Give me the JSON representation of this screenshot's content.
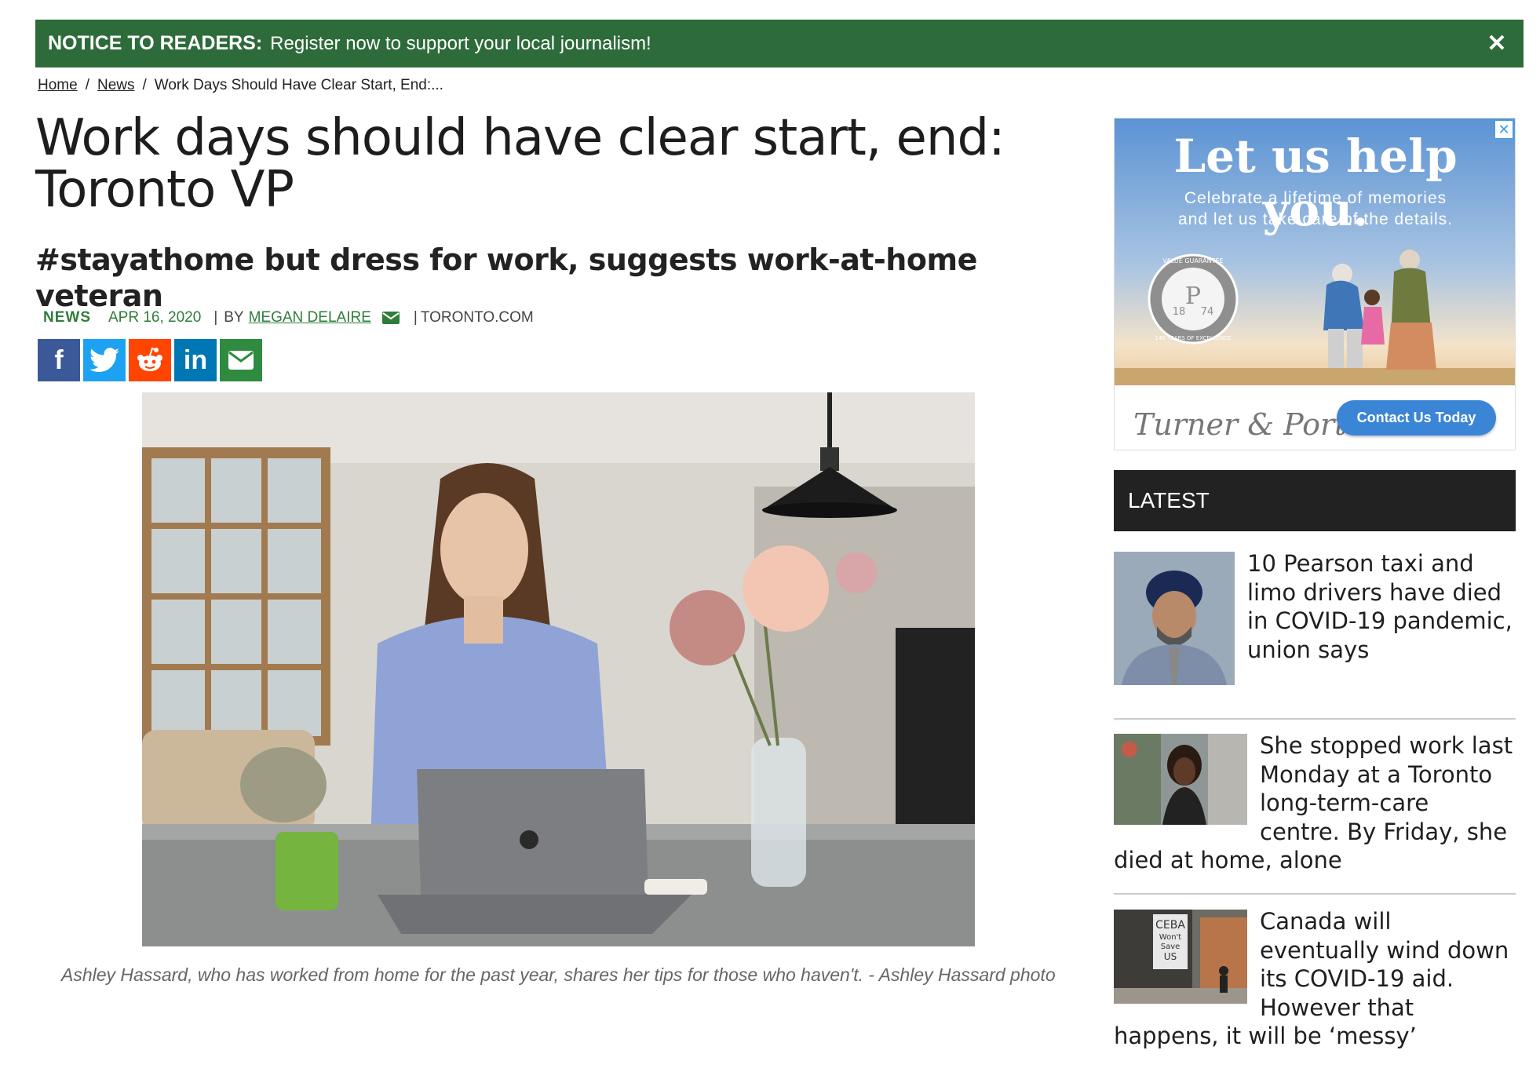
{
  "notice": {
    "lead": "NOTICE TO READERS:",
    "text": "Register now to support your local journalism!",
    "close": "✕"
  },
  "breadcrumb": {
    "home": "Home",
    "sep1": "/",
    "news": "News",
    "sep2": "/",
    "current": "Work Days Should Have Clear Start, End:..."
  },
  "article": {
    "headline": "Work days should have clear start, end: Toronto VP",
    "subhead": "#stayathome but dress for work, suggests work-at-home veteran",
    "category": "NEWS",
    "date": "APR 16, 2020",
    "sep": "|",
    "by": "BY",
    "author": "MEGAN DELAIRE",
    "source_sep": "|",
    "source": "TORONTO.COM",
    "caption": "Ashley Hassard, who has worked from home for the past year, shares her tips for those who haven't. - Ashley Hassard photo"
  },
  "share": {
    "facebook": "f",
    "twitter_icon": "twitter-icon",
    "reddit_icon": "reddit-icon",
    "linkedin": "in",
    "email_icon": "envelope-icon"
  },
  "ad": {
    "title": "Let us help you.",
    "subtitle_line1": "Celebrate a lifetime of memories",
    "subtitle_line2": "and let us take care of the details.",
    "badge_top": "VALUE GUARANTEE",
    "badge_year_left": "18",
    "badge_year_right": "74",
    "badge_bottom": "140 YEARS OF EXCELLENCE",
    "brand": "Turner & Porter",
    "cta": "Contact Us Today",
    "close": "✕"
  },
  "latest": {
    "heading": "LATEST",
    "stories": [
      {
        "title": "10 Pearson taxi and limo drivers have died in COVID-19 pandemic, union says"
      },
      {
        "title": "She stopped work last Monday at a Toronto long-term-care centre. By Friday, she died at home, alone"
      },
      {
        "title": "Canada will eventually wind down its COVID-19 aid. However that happens, it will be ‘messy’"
      }
    ],
    "thumb3_sign_l1": "CEBA",
    "thumb3_sign_l2": "Won't",
    "thumb3_sign_l3": "Save",
    "thumb3_sign_l4": "US"
  },
  "colors": {
    "notice_bg": "#2e6b3a",
    "accent_green": "#2e7d3a",
    "latest_bg": "#222222",
    "cta_blue": "#3b85d6"
  }
}
